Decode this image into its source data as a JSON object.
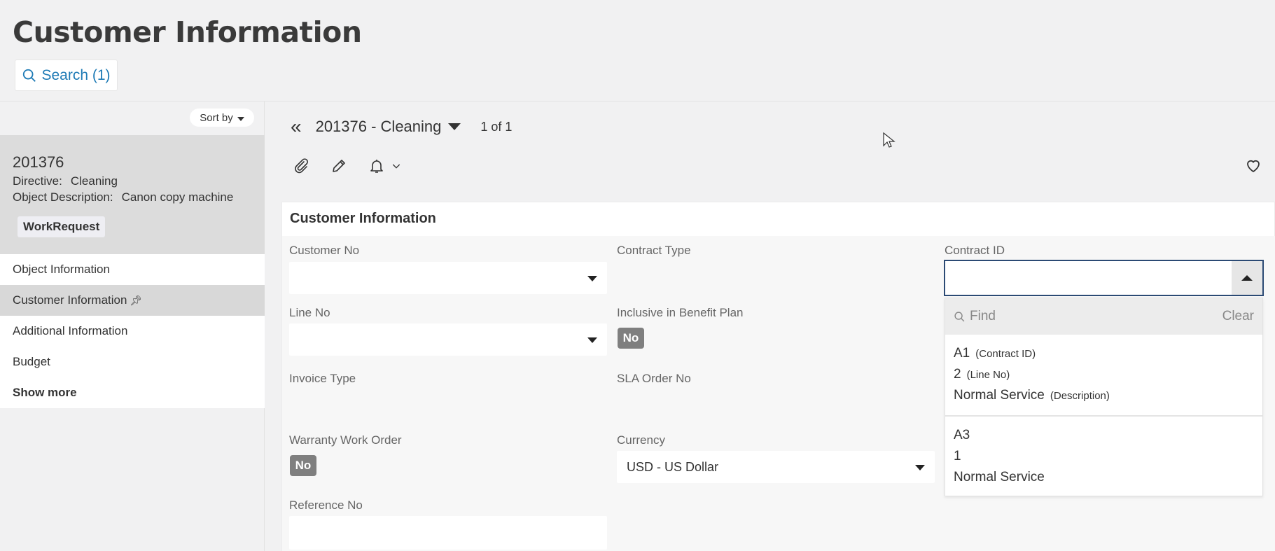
{
  "page": {
    "title": "Customer Information"
  },
  "search": {
    "label": "Search (1)"
  },
  "sidebar": {
    "sort_label": "Sort by",
    "record": {
      "id": "201376",
      "directive_label": "Directive:",
      "directive_value": "Cleaning",
      "objdesc_label": "Object Description:",
      "objdesc_value": "Canon copy machine",
      "badge": "WorkRequest"
    },
    "nav": [
      {
        "label": "Object Information"
      },
      {
        "label": "Customer Information"
      },
      {
        "label": "Additional Information"
      },
      {
        "label": "Budget"
      },
      {
        "label": "Show more"
      }
    ],
    "pin_glyph": "⊼"
  },
  "header": {
    "record_title": "201376 - Cleaning",
    "pager": "1 of 1"
  },
  "panel": {
    "title": "Customer Information",
    "fields": {
      "customer_no": {
        "label": "Customer No",
        "value": ""
      },
      "contract_type": {
        "label": "Contract Type"
      },
      "contract_id": {
        "label": "Contract ID",
        "value": ""
      },
      "line_no": {
        "label": "Line No",
        "value": ""
      },
      "inclusive": {
        "label": "Inclusive in Benefit Plan",
        "value": "No"
      },
      "invoice_type": {
        "label": "Invoice Type"
      },
      "sla_order": {
        "label": "SLA Order No"
      },
      "warranty": {
        "label": "Warranty Work Order",
        "value": "No"
      },
      "currency": {
        "label": "Currency",
        "value": "USD - US Dollar"
      },
      "reference": {
        "label": "Reference No",
        "value": ""
      }
    }
  },
  "dropdown": {
    "find_placeholder": "Find",
    "clear_label": "Clear",
    "options": [
      {
        "contract_id": "A1",
        "contract_id_hint": "(Contract ID)",
        "line_no": "2",
        "line_no_hint": "(Line No)",
        "description": "Normal Service",
        "description_hint": "(Description)"
      },
      {
        "contract_id": "A3",
        "line_no": "1",
        "description": "Normal Service"
      }
    ]
  },
  "colors": {
    "accent": "#1f7bb6",
    "toggle_off": "#7f7f7f",
    "focus_border": "#2b4a74"
  }
}
